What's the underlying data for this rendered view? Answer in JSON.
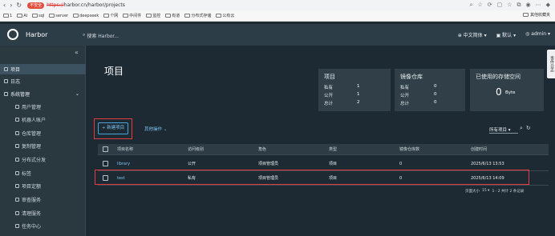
{
  "browser": {
    "insecure_label": "不安全",
    "url_scheme": "https://",
    "url_rest": "harbor.cn/harbor/projects",
    "bookmarks": [
      {
        "label": "1"
      },
      {
        "label": "AI"
      },
      {
        "label": "sql"
      },
      {
        "label": "server"
      },
      {
        "label": "deepseek"
      },
      {
        "label": "个网"
      },
      {
        "label": "中间件"
      },
      {
        "label": "监控"
      },
      {
        "label": "有道"
      },
      {
        "label": "分布式存储"
      },
      {
        "label": "公有云"
      }
    ],
    "other_bookmarks": "其他收藏夹"
  },
  "header": {
    "brand": "Harbor",
    "search_placeholder": "搜索 Harbor...",
    "language": "中文简体",
    "theme": "默认",
    "user": "admin"
  },
  "sidebar": {
    "items": [
      {
        "label": "项目",
        "active": true
      },
      {
        "label": "日志"
      },
      {
        "label": "系统管理"
      },
      {
        "label": "用户管理"
      },
      {
        "label": "机器人账户"
      },
      {
        "label": "仓库管理"
      },
      {
        "label": "复制管理"
      },
      {
        "label": "分布式分发"
      },
      {
        "label": "标签"
      },
      {
        "label": "项目定额"
      },
      {
        "label": "审查服务"
      },
      {
        "label": "清理服务"
      },
      {
        "label": "任务中心"
      }
    ]
  },
  "main": {
    "title": "项目",
    "cards": {
      "projects": {
        "title": "项目",
        "rows": [
          {
            "label": "私有",
            "value": "1"
          },
          {
            "label": "公开",
            "value": "1"
          },
          {
            "label": "总计",
            "value": "2"
          }
        ]
      },
      "repos": {
        "title": "镜像仓库",
        "rows": [
          {
            "label": "私有",
            "value": "0"
          },
          {
            "label": "公开",
            "value": "0"
          },
          {
            "label": "总计",
            "value": "0"
          }
        ]
      },
      "storage": {
        "title": "已使用的存储空间",
        "value": "0",
        "unit": "Byte"
      }
    },
    "new_project": "+ 新建项目",
    "more_actions": "其他操作",
    "filter": "所有项目",
    "table": {
      "headers": [
        "项目名称",
        "访问级别",
        "角色",
        "类型",
        "镜像仓库数",
        "创建时间"
      ],
      "rows": [
        {
          "name": "library",
          "access": "公开",
          "role": "项目管理员",
          "type": "项目",
          "repos": "0",
          "created": "2025/6/13 13:53"
        },
        {
          "name": "test",
          "access": "私有",
          "role": "项目管理员",
          "type": "项目",
          "repos": "0",
          "created": "2025/6/13 14:09"
        }
      ],
      "page_size_label": "页面大小",
      "page_size": "15",
      "summary": "1 - 2 共计 2 条记录"
    },
    "side_tab": "事件日志"
  }
}
